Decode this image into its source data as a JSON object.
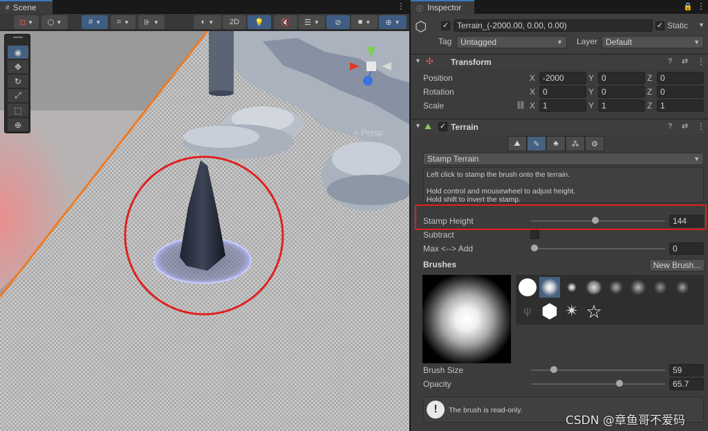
{
  "scene": {
    "tab_label": "Scene",
    "toolbar": {
      "mode_2d": "2D"
    },
    "persp_label": "< Persp"
  },
  "inspector": {
    "tab_label": "Inspector",
    "object_name": "Terrain_(-2000.00, 0.00, 0.00)",
    "static_label": "Static",
    "tag_label": "Tag",
    "tag_value": "Untagged",
    "layer_label": "Layer",
    "layer_value": "Default",
    "transform": {
      "title": "Transform",
      "rows": [
        {
          "label": "Position",
          "x": "-2000",
          "y": "0",
          "z": "0"
        },
        {
          "label": "Rotation",
          "x": "0",
          "y": "0",
          "z": "0"
        },
        {
          "label": "Scale",
          "x": "1",
          "y": "1",
          "z": "1"
        }
      ],
      "axes": [
        "X",
        "Y",
        "Z"
      ]
    },
    "terrain": {
      "title": "Terrain",
      "tool_dropdown": "Stamp Terrain",
      "help_lines": [
        "Left click to stamp the brush onto the terrain.",
        "Hold control and mousewheel to adjust height.",
        "Hold shift to invert the stamp."
      ],
      "stamp_height_label": "Stamp Height",
      "stamp_height_value": "144",
      "stamp_height_fraction": 0.48,
      "subtract_label": "Subtract",
      "max_add_label": "Max <--> Add",
      "max_add_value": "0",
      "max_add_fraction": 0.0,
      "brushes_label": "Brushes",
      "new_brush_label": "New Brush...",
      "brush_size_label": "Brush Size",
      "brush_size_value": "59",
      "brush_size_fraction": 0.17,
      "opacity_label": "Opacity",
      "opacity_value": "65.7",
      "opacity_fraction": 0.66,
      "readonly_note": "The brush is read-only."
    }
  },
  "watermark": "CSDN @章鱼哥不爱码",
  "colors": {
    "highlight_red": "#e02020",
    "active_blue": "#46607f",
    "selection_orange": "#f07a20"
  }
}
